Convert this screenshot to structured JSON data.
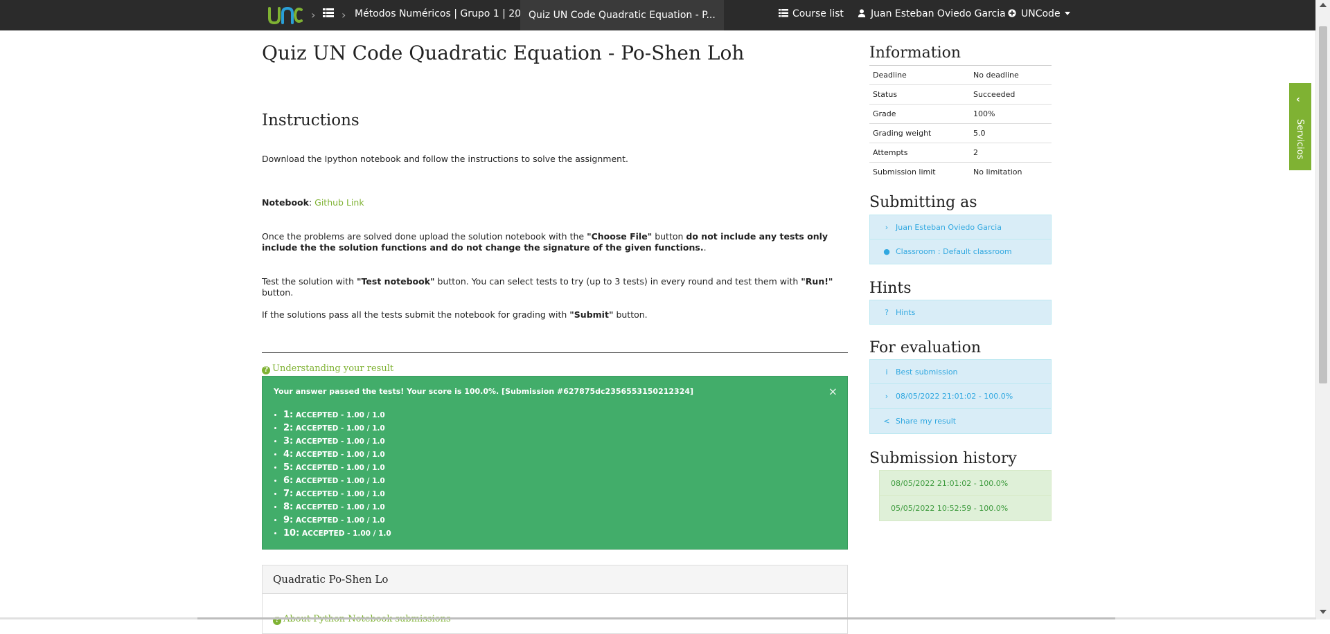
{
  "nav": {
    "breadcrumb_course": "Métodos Numéricos | Grupo 1 | 2022...",
    "breadcrumb_task": "Quiz UN Code Quadratic Equation - P...",
    "course_list": "Course list",
    "user": "Juan Esteban Oviedo Garcia",
    "uncode": "UNCode"
  },
  "task": {
    "title": "Quiz UN Code Quadratic Equation - Po-Shen Loh",
    "instructions_heading": "Instructions",
    "p_download": "Download the Ipython notebook and follow the instructions to solve the assignment.",
    "notebook_label": "Notebook",
    "notebook_sep": ": ",
    "notebook_link": "Github Link",
    "p_upload_1": "Once the problems are solved done upload the solution notebook with the ",
    "p_upload_choose": "\"Choose File\"",
    "p_upload_2": " button ",
    "p_upload_bold": "do not include any tests only include the the solution functions and do not change the signature of the given functions.",
    "p_upload_3": ".",
    "p_test_1": "Test the solution with ",
    "p_test_btn": "\"Test notebook\"",
    "p_test_2": " button. You can select tests to try (up to 3 tests) in every round and test them with ",
    "p_test_run": "\"Run!\"",
    "p_test_3": " button.",
    "p_submit_1": "If the solutions pass all the tests submit the notebook for grading with ",
    "p_submit_btn": "\"Submit\"",
    "p_submit_2": " button.",
    "understanding": "Understanding your result"
  },
  "result": {
    "message": "Your answer passed the tests! Your score is 100.0%. [Submission #627875dc2356553150212324]",
    "close": "×",
    "tests": [
      {
        "num": "1:",
        "text": "ACCEPTED - 1.00 / 1.0"
      },
      {
        "num": "2:",
        "text": "ACCEPTED - 1.00 / 1.0"
      },
      {
        "num": "3:",
        "text": "ACCEPTED - 1.00 / 1.0"
      },
      {
        "num": "4:",
        "text": "ACCEPTED - 1.00 / 1.0"
      },
      {
        "num": "5:",
        "text": "ACCEPTED - 1.00 / 1.0"
      },
      {
        "num": "6:",
        "text": "ACCEPTED - 1.00 / 1.0"
      },
      {
        "num": "7:",
        "text": "ACCEPTED - 1.00 / 1.0"
      },
      {
        "num": "8:",
        "text": "ACCEPTED - 1.00 / 1.0"
      },
      {
        "num": "9:",
        "text": "ACCEPTED - 1.00 / 1.0"
      },
      {
        "num": "10:",
        "text": "ACCEPTED - 1.00 / 1.0"
      }
    ]
  },
  "panel": {
    "heading": "Quadratic Po-Shen Lo",
    "faint_link": "About Python Notebook submissions"
  },
  "sidebar": {
    "information_heading": "Information",
    "info": [
      {
        "label": "Deadline",
        "value": "No deadline"
      },
      {
        "label": "Status",
        "value": "Succeeded"
      },
      {
        "label": "Grade",
        "value": "100%"
      },
      {
        "label": "Grading weight",
        "value": "5.0"
      },
      {
        "label": "Attempts",
        "value": "2"
      },
      {
        "label": "Submission limit",
        "value": "No limitation"
      }
    ],
    "submitting_heading": "Submitting as",
    "submitting_user": "Juan Esteban Oviedo Garcia",
    "classroom": "Classroom : Default classroom",
    "hints_heading": "Hints",
    "hints": "Hints",
    "evaluation_heading": "For evaluation",
    "best_submission": "Best submission",
    "eval_submission": "08/05/2022 21:01:02 - 100.0%",
    "share": "Share my result",
    "history_heading": "Submission history",
    "history": [
      "08/05/2022 21:01:02 - 100.0%",
      "05/05/2022 10:52:59 - 100.0%"
    ]
  },
  "servicios": "Servicios",
  "colors": {
    "accent_green": "#7fb233",
    "success_green": "#42ad6a",
    "info_blue_bg": "#d9edf7",
    "info_blue_text": "#31a8e0",
    "navbar": "#2b2b2b"
  }
}
